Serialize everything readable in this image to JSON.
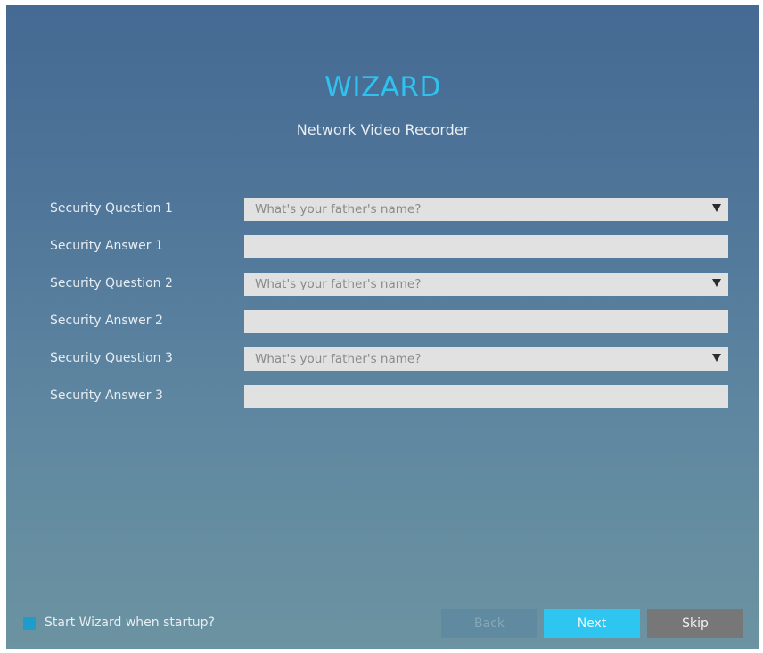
{
  "wizard": {
    "title": "WIZARD",
    "subtitle": "Network Video Recorder"
  },
  "form": {
    "rows": [
      {
        "label": "Security Question 1",
        "type": "select",
        "value": "What's your father's name?"
      },
      {
        "label": "Security Answer 1",
        "type": "input",
        "value": ""
      },
      {
        "label": "Security Question 2",
        "type": "select",
        "value": "What's your father's name?"
      },
      {
        "label": "Security Answer 2",
        "type": "input",
        "value": ""
      },
      {
        "label": "Security Question 3",
        "type": "select",
        "value": "What's your father's name?"
      },
      {
        "label": "Security Answer 3",
        "type": "input",
        "value": ""
      }
    ]
  },
  "footer": {
    "startup_label": "Start Wizard when startup?",
    "startup_checked": true,
    "back_label": "Back",
    "next_label": "Next",
    "skip_label": "Skip"
  },
  "colors": {
    "title": "#2fc2ef",
    "next_button": "#2ec5f1",
    "skip_button": "#777777",
    "checkbox": "#1e9ccc"
  },
  "icons": {
    "dropdown": "chevron-down-icon"
  }
}
